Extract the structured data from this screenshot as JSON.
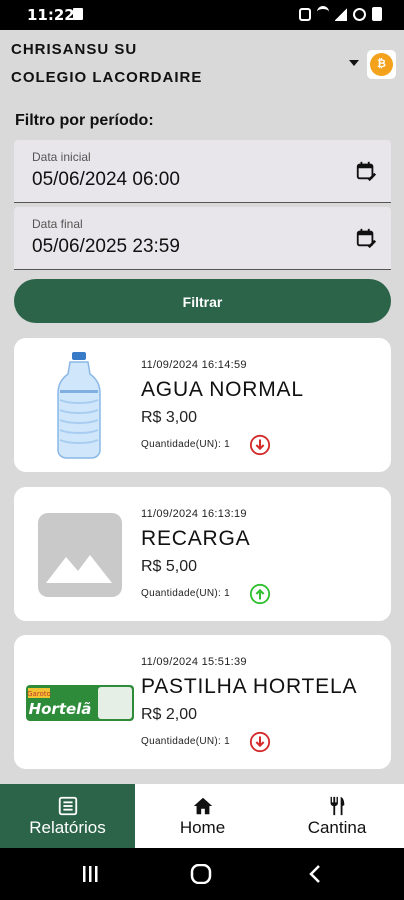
{
  "status_bar": {
    "time": "11:22"
  },
  "header": {
    "user_name": "CHRISANSU SU",
    "school": "COLEGIO LACORDAIRE"
  },
  "filter": {
    "title": "Filtro por período:",
    "start_label": "Data inicial",
    "start_value": "05/06/2024 06:00",
    "end_label": "Data final",
    "end_value": "05/06/2025 23:59",
    "button_label": "Filtrar"
  },
  "transactions": [
    {
      "datetime": "11/09/2024 16:14:59",
      "name": "AGUA NORMAL",
      "price": "R$ 3,00",
      "quantity": "Quantidade(UN): 1",
      "direction": "out",
      "image": "water-bottle"
    },
    {
      "datetime": "11/09/2024 16:13:19",
      "name": "RECARGA",
      "price": "R$ 5,00",
      "quantity": "Quantidade(UN): 1",
      "direction": "in",
      "image": "placeholder-image"
    },
    {
      "datetime": "11/09/2024 15:51:39",
      "name": "PASTILHA HORTELA",
      "price": "R$ 2,00",
      "quantity": "Quantidade(UN): 1",
      "direction": "out",
      "image": "mint-candy-pack"
    }
  ],
  "image_text": {
    "brand": "Garoto",
    "flavor": "Hortelã"
  },
  "nav": [
    {
      "label": "Relatórios",
      "icon": "report-icon",
      "active": true
    },
    {
      "label": "Home",
      "icon": "home-icon",
      "active": false
    },
    {
      "label": "Cantina",
      "icon": "cutlery-icon",
      "active": false
    }
  ],
  "colors": {
    "primary": "#2c6449",
    "out_arrow": "#d42a2a",
    "in_arrow": "#2fbf2f",
    "background": "#d9d9d9"
  }
}
